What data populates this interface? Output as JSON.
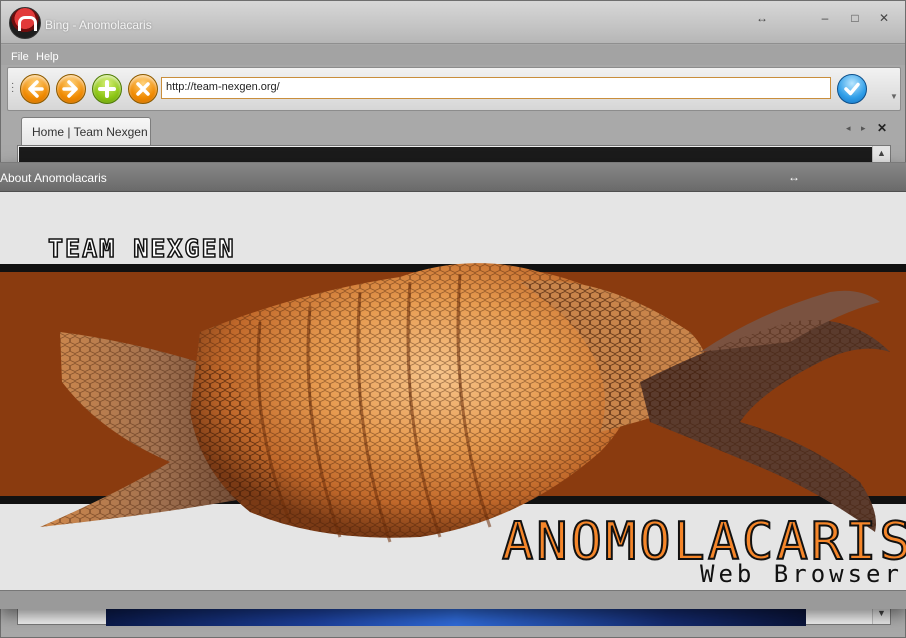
{
  "window": {
    "title": "Bing - Anomolacaris",
    "controls": {
      "resize": "↔",
      "minimize": "–",
      "maximize": "□",
      "close": "✕"
    }
  },
  "menu": {
    "items": [
      "File",
      "Help"
    ]
  },
  "toolbar": {
    "back_icon": "arrow-left",
    "forward_icon": "arrow-right",
    "add_icon": "plus",
    "stop_icon": "x",
    "address_value": "http://team-nexgen.org/",
    "go_icon": "checkmark"
  },
  "tabs": [
    {
      "label": "Home | Team Nexgen"
    }
  ],
  "about_dialog": {
    "title": "About Anomolacaris",
    "resize_glyph": "↔",
    "team_name": "TEAM NEXGEN",
    "product_name": "ANOMOLACARIS",
    "product_subtitle": "Web Browser",
    "colors": {
      "band": "#8a3b0f",
      "product_text": "#f5862a"
    }
  }
}
